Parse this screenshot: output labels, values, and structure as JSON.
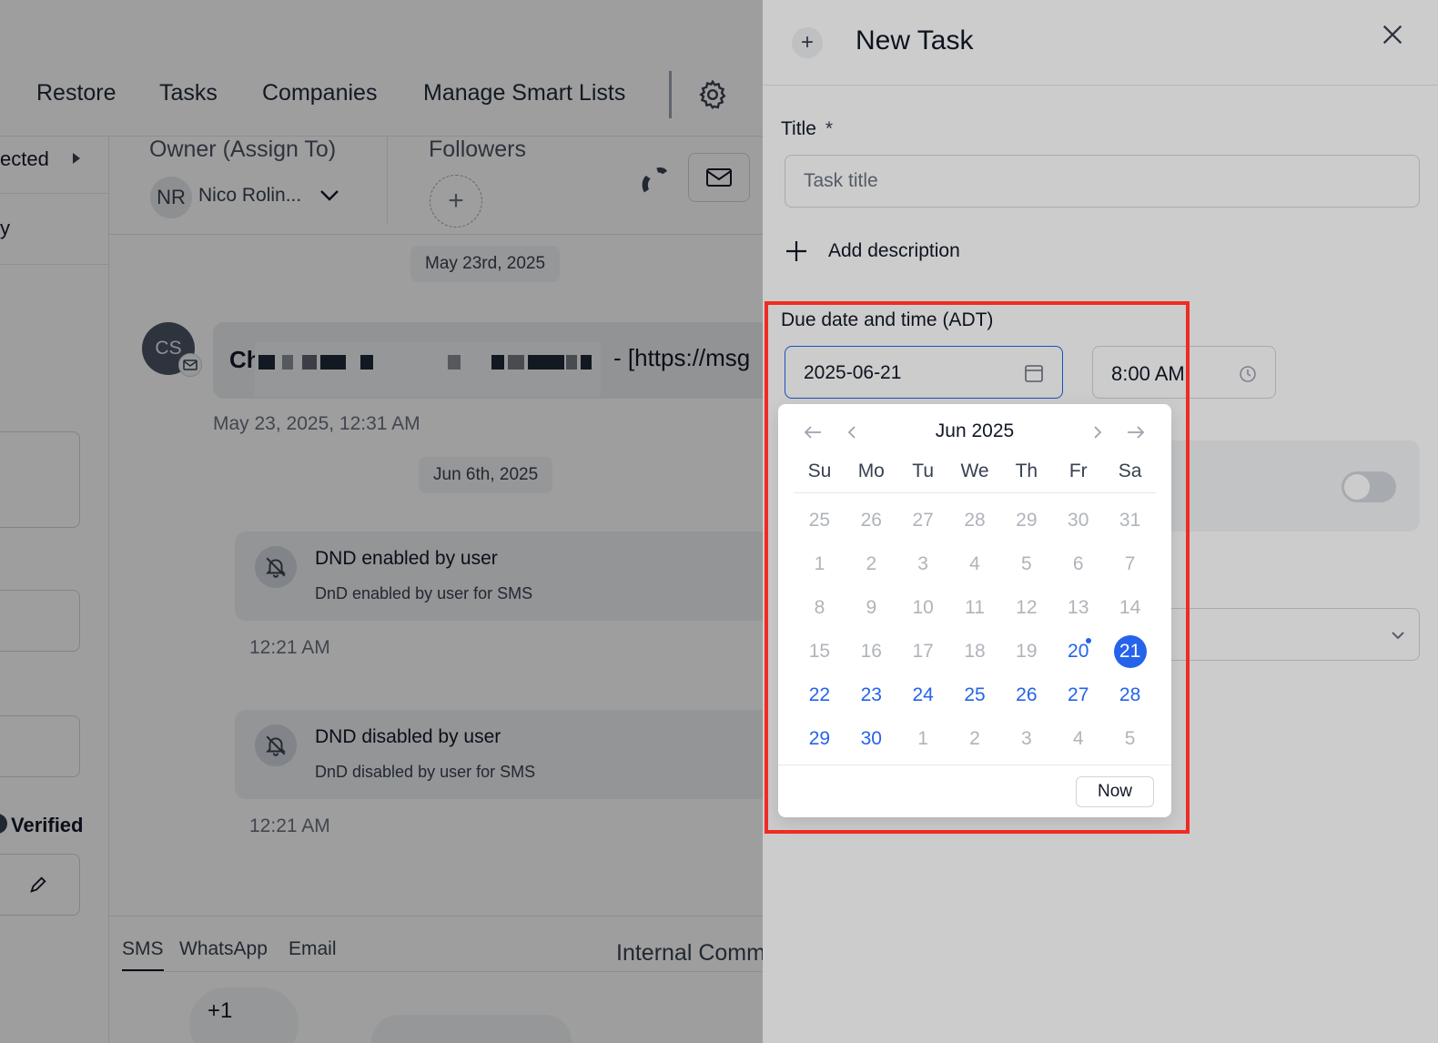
{
  "nav": {
    "items": [
      "Restore",
      "Tasks",
      "Companies",
      "Manage Smart Lists"
    ],
    "gear_icon": "gear-icon"
  },
  "left": {
    "selected_label": "ected",
    "partial_label": "y",
    "verified_label": "Verified"
  },
  "owner": {
    "label": "Owner (Assign To)",
    "initials": "NR",
    "name": "Nico Rolin...",
    "followers_label": "Followers",
    "followers_add": "+"
  },
  "chat": {
    "date1": "May 23rd, 2025",
    "avatar_initials": "CS",
    "message_start": "Ch",
    "message_link": "-  [https://msg",
    "message_time": "May 23, 2025, 12:31 AM",
    "date2": "Jun 6th, 2025",
    "events": [
      {
        "title": "DND enabled by user",
        "sub": "DnD enabled by user for SMS",
        "time": "12:21 AM"
      },
      {
        "title": "DND disabled by user",
        "sub": "DnD disabled by user for SMS",
        "time": "12:21 AM"
      }
    ]
  },
  "composer": {
    "tabs": [
      "SMS",
      "WhatsApp",
      "Email"
    ],
    "internal": "Internal Comm",
    "phone_prefix": "+1"
  },
  "drawer": {
    "plus": "+",
    "title": "New Task",
    "title_label": "Title",
    "required_mark": "*",
    "title_placeholder": "Task title",
    "add_description": "Add description",
    "due_label": "Due date and time (ADT)",
    "date_value": "2025-06-21",
    "time_value": "8:00 AM"
  },
  "picker": {
    "month_label": "Jun 2025",
    "weekdays": [
      "Su",
      "Mo",
      "Tu",
      "We",
      "Th",
      "Fr",
      "Sa"
    ],
    "weeks": [
      [
        {
          "d": "25",
          "s": "muted"
        },
        {
          "d": "26",
          "s": "muted"
        },
        {
          "d": "27",
          "s": "muted"
        },
        {
          "d": "28",
          "s": "muted"
        },
        {
          "d": "29",
          "s": "muted"
        },
        {
          "d": "30",
          "s": "muted"
        },
        {
          "d": "31",
          "s": "muted"
        }
      ],
      [
        {
          "d": "1",
          "s": "muted"
        },
        {
          "d": "2",
          "s": "muted"
        },
        {
          "d": "3",
          "s": "muted"
        },
        {
          "d": "4",
          "s": "muted"
        },
        {
          "d": "5",
          "s": "muted"
        },
        {
          "d": "6",
          "s": "muted"
        },
        {
          "d": "7",
          "s": "muted"
        }
      ],
      [
        {
          "d": "8",
          "s": "muted"
        },
        {
          "d": "9",
          "s": "muted"
        },
        {
          "d": "10",
          "s": "muted"
        },
        {
          "d": "11",
          "s": "muted"
        },
        {
          "d": "12",
          "s": "muted"
        },
        {
          "d": "13",
          "s": "muted"
        },
        {
          "d": "14",
          "s": "muted"
        }
      ],
      [
        {
          "d": "15",
          "s": "muted"
        },
        {
          "d": "16",
          "s": "muted"
        },
        {
          "d": "17",
          "s": "muted"
        },
        {
          "d": "18",
          "s": "muted"
        },
        {
          "d": "19",
          "s": "muted"
        },
        {
          "d": "20",
          "s": "today"
        },
        {
          "d": "21",
          "s": "selected"
        }
      ],
      [
        {
          "d": "22",
          "s": "active"
        },
        {
          "d": "23",
          "s": "active"
        },
        {
          "d": "24",
          "s": "active"
        },
        {
          "d": "25",
          "s": "active"
        },
        {
          "d": "26",
          "s": "active"
        },
        {
          "d": "27",
          "s": "active"
        },
        {
          "d": "28",
          "s": "active"
        }
      ],
      [
        {
          "d": "29",
          "s": "active"
        },
        {
          "d": "30",
          "s": "active"
        },
        {
          "d": "1",
          "s": "muted"
        },
        {
          "d": "2",
          "s": "muted"
        },
        {
          "d": "3",
          "s": "muted"
        },
        {
          "d": "4",
          "s": "muted"
        },
        {
          "d": "5",
          "s": "muted"
        }
      ]
    ],
    "now_label": "Now",
    "accent_color": "#2563eb",
    "highlight_color": "#ef2b24"
  }
}
